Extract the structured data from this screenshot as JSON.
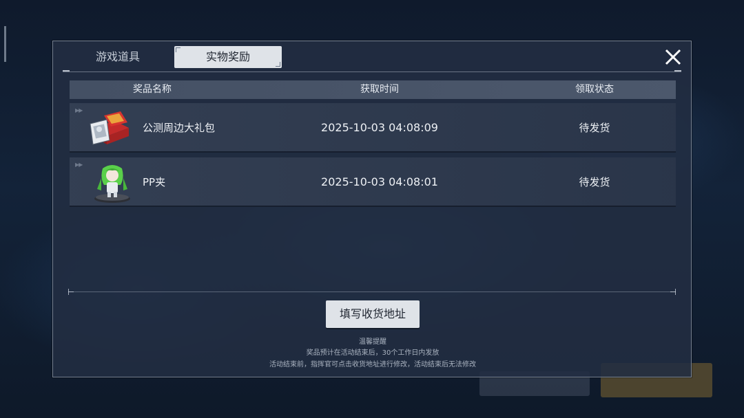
{
  "tabs": {
    "game_items": "游戏道具",
    "physical_rewards": "实物奖励"
  },
  "table": {
    "headers": {
      "name": "奖品名称",
      "time": "获取时间",
      "status": "领取状态"
    },
    "rows": [
      {
        "name": "公测周边大礼包",
        "time": "2025-10-03 04:08:09",
        "status": "待发货",
        "icon": "gift-box-icon"
      },
      {
        "name": "PP夹",
        "time": "2025-10-03 04:08:01",
        "status": "待发货",
        "icon": "character-figure-icon"
      }
    ]
  },
  "address_button": "填写收货地址",
  "tips": {
    "title": "温馨提醒",
    "line1": "奖品预计在活动结束后，30个工作日内发放",
    "line2": "活动结束前，指挥官可点击收货地址进行修改，活动结束后无法修改"
  },
  "colors": {
    "tab_active_bg": "#dfe3e8",
    "panel_bg": "#222e42",
    "text": "#e8ecf2"
  }
}
